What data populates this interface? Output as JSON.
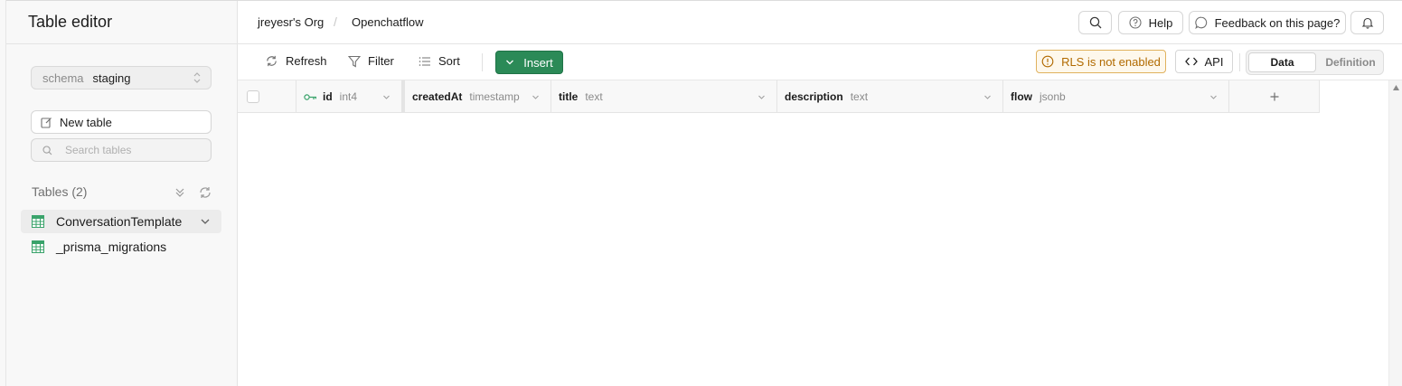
{
  "sidebar": {
    "title": "Table editor",
    "schema": {
      "label": "schema",
      "value": "staging"
    },
    "new_table_label": "New table",
    "search_placeholder": "Search tables",
    "tables_heading": "Tables (2)",
    "tables": [
      {
        "name": "ConversationTemplate",
        "active": true
      },
      {
        "name": "_prisma_migrations",
        "active": false
      }
    ]
  },
  "topbar": {
    "breadcrumb": [
      "jreyesr's Org",
      "Openchatflow"
    ],
    "help_label": "Help",
    "feedback_label": "Feedback on this page?"
  },
  "toolbar": {
    "refresh_label": "Refresh",
    "filter_label": "Filter",
    "sort_label": "Sort",
    "insert_label": "Insert",
    "rls_label": "RLS is not enabled",
    "api_label": "API",
    "view_tabs": [
      "Data",
      "Definition"
    ],
    "active_view": "Data"
  },
  "grid": {
    "columns": [
      {
        "name": "id",
        "type": "int4",
        "primary_key": true
      },
      {
        "name": "createdAt",
        "type": "timestamp"
      },
      {
        "name": "title",
        "type": "text"
      },
      {
        "name": "description",
        "type": "text"
      },
      {
        "name": "flow",
        "type": "jsonb"
      }
    ],
    "add_column_label": "+"
  },
  "colors": {
    "accent_green": "#2b8a57",
    "table_icon_green": "#3aa36b",
    "warning_text": "#b16a00",
    "warning_border": "#e0b25e"
  }
}
